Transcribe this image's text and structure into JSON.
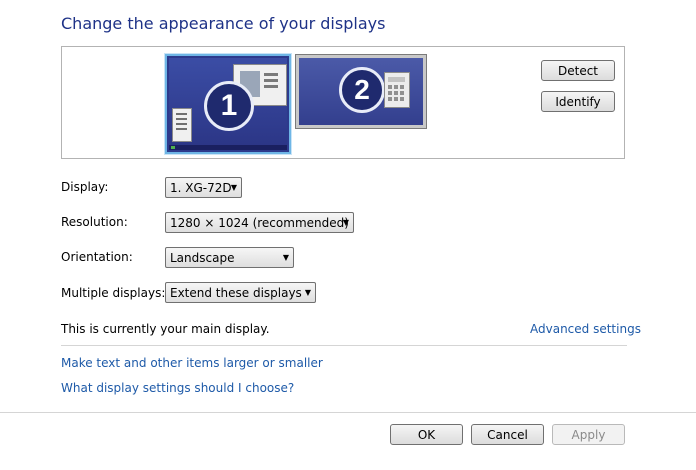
{
  "header": {
    "title": "Change the appearance of your displays"
  },
  "preview": {
    "monitor1_number": "1",
    "monitor2_number": "2",
    "detect_label": "Detect",
    "identify_label": "Identify"
  },
  "settings": {
    "display_label": "Display:",
    "display_value": "1. XG-72D",
    "resolution_label": "Resolution:",
    "resolution_value": "1280 × 1024 (recommended)",
    "orientation_label": "Orientation:",
    "orientation_value": "Landscape",
    "multiple_label": "Multiple displays:",
    "multiple_value": "Extend these displays"
  },
  "status": {
    "main_display_text": "This is currently your main display.",
    "advanced_link": "Advanced settings"
  },
  "links": {
    "text_size": "Make text and other items larger or smaller",
    "which_settings": "What display settings should I choose?"
  },
  "footer": {
    "ok_label": "OK",
    "cancel_label": "Cancel",
    "apply_label": "Apply"
  },
  "colors": {
    "title": "#1e3287",
    "link": "#1e5aa8",
    "monitor_blue": "#2d3a8c",
    "selected_border": "#6fb6e6"
  }
}
